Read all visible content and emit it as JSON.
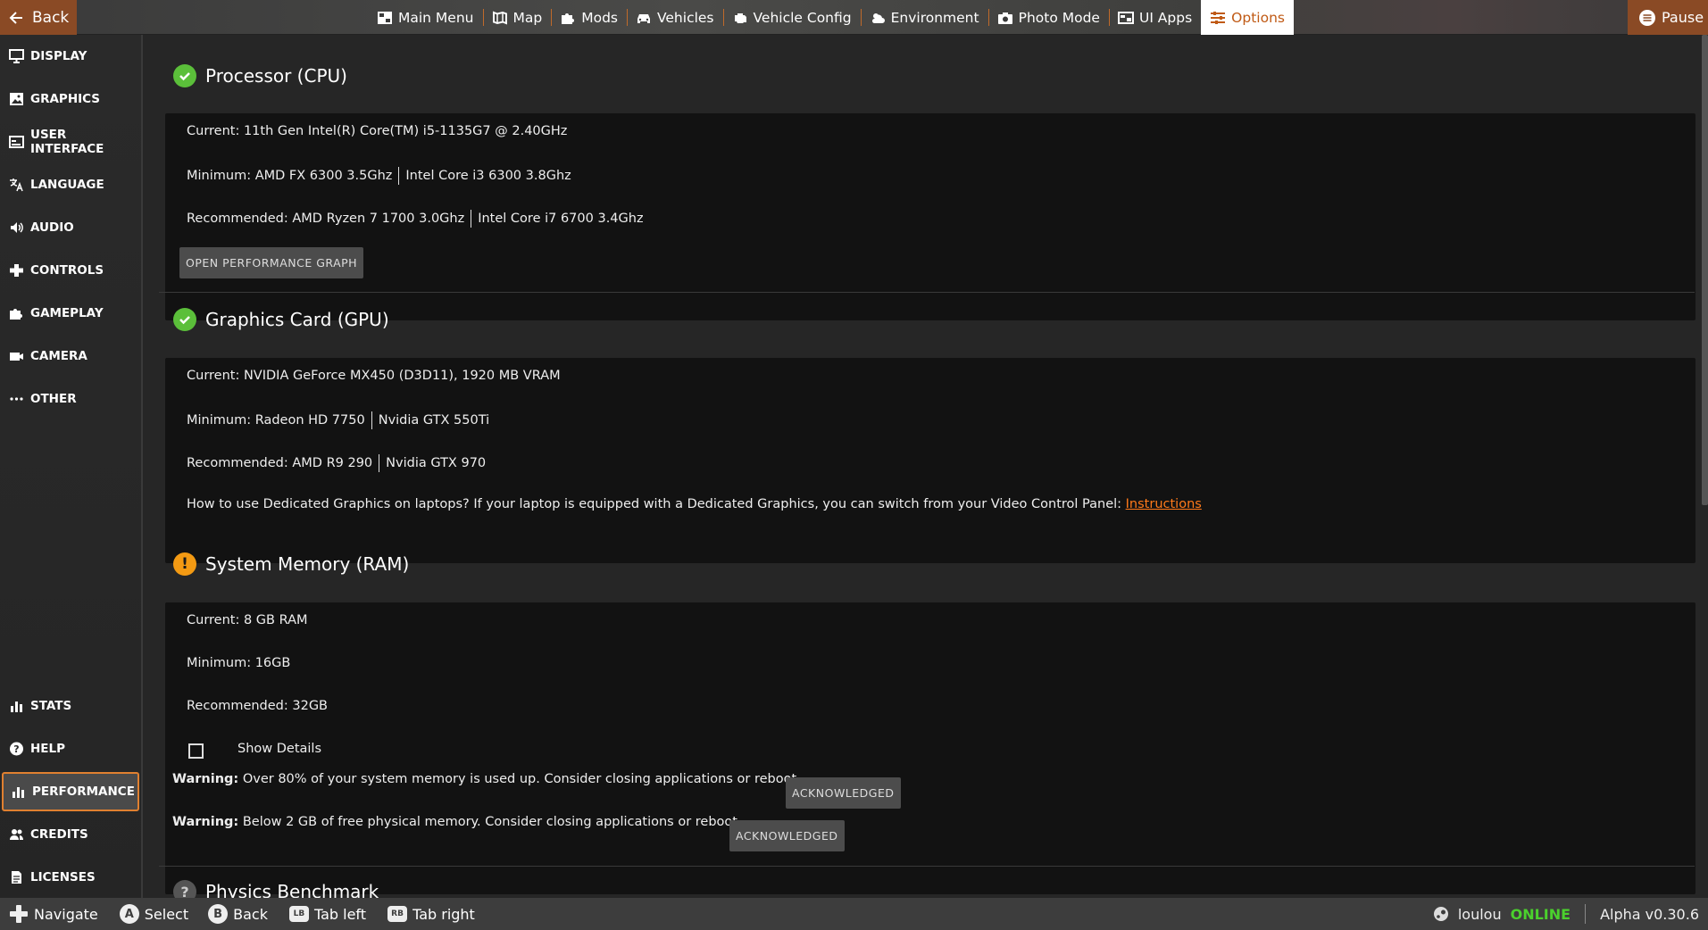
{
  "topbar": {
    "back_label": "Back",
    "pause_label": "Pause",
    "nav": [
      {
        "label": "Main Menu",
        "icon": "main-menu-icon"
      },
      {
        "label": "Map",
        "icon": "map-icon"
      },
      {
        "label": "Mods",
        "icon": "puzzle-icon"
      },
      {
        "label": "Vehicles",
        "icon": "car-icon"
      },
      {
        "label": "Vehicle Config",
        "icon": "engine-icon"
      },
      {
        "label": "Environment",
        "icon": "weather-icon"
      },
      {
        "label": "Photo Mode",
        "icon": "camera-icon"
      },
      {
        "label": "UI Apps",
        "icon": "ui-apps-icon"
      },
      {
        "label": "Options",
        "icon": "sliders-icon",
        "active": true
      }
    ]
  },
  "sidebar": {
    "items": [
      {
        "label": "DISPLAY",
        "icon": "monitor-icon"
      },
      {
        "label": "GRAPHICS",
        "icon": "image-icon"
      },
      {
        "label": "USER INTERFACE",
        "icon": "window-icon"
      },
      {
        "label": "LANGUAGE",
        "icon": "translate-icon"
      },
      {
        "label": "AUDIO",
        "icon": "speaker-icon"
      },
      {
        "label": "CONTROLS",
        "icon": "gamepad-icon"
      },
      {
        "label": "GAMEPLAY",
        "icon": "puzzle-icon"
      },
      {
        "label": "CAMERA",
        "icon": "video-icon"
      },
      {
        "label": "OTHER",
        "icon": "more-icon"
      }
    ],
    "bottom_items": [
      {
        "label": "STATS",
        "icon": "stats-icon"
      },
      {
        "label": "HELP",
        "icon": "help-icon"
      },
      {
        "label": "PERFORMANCE",
        "icon": "stats-icon",
        "active": true
      },
      {
        "label": "CREDITS",
        "icon": "people-icon"
      },
      {
        "label": "LICENSES",
        "icon": "document-icon"
      }
    ]
  },
  "cpu": {
    "title": "Processor (CPU)",
    "status": "ok",
    "current": "Current: 11th Gen Intel(R) Core(TM) i5-1135G7 @ 2.40GHz",
    "minimum_a": "Minimum: AMD FX 6300 3.5Ghz",
    "minimum_b": "Intel Core i3 6300 3.8Ghz",
    "recommended_a": "Recommended: AMD Ryzen 7 1700 3.0Ghz",
    "recommended_b": "Intel Core i7 6700 3.4Ghz",
    "graph_button": "OPEN PERFORMANCE GRAPH"
  },
  "gpu": {
    "title": "Graphics Card (GPU)",
    "status": "ok",
    "current": "Current: NVIDIA GeForce MX450 (D3D11), 1920 MB VRAM",
    "minimum_a": "Minimum: Radeon HD 7750",
    "minimum_b": "Nvidia GTX 550Ti",
    "recommended_a": "Recommended: AMD R9 290",
    "recommended_b": "Nvidia GTX 970",
    "laptop_note": "How to use Dedicated Graphics on laptops? If your laptop is equipped with a Dedicated Graphics, you can switch from your Video Control Panel: ",
    "instructions_link": "Instructions"
  },
  "ram": {
    "title": "System Memory (RAM)",
    "status": "warning",
    "status_glyph": "!",
    "current": "Current: 8 GB RAM",
    "minimum": "Minimum: 16GB",
    "recommended": "Recommended: 32GB",
    "show_details": "Show Details",
    "warnings": [
      {
        "prefix": "Warning:",
        "text": " Over 80% of your system memory is used up. Consider closing applications or reboot.",
        "button": "ACKNOWLEDGED"
      },
      {
        "prefix": "Warning:",
        "text": " Below 2 GB of free physical memory. Consider closing applications or reboot.",
        "button": "ACKNOWLEDGED"
      }
    ]
  },
  "physics": {
    "title": "Physics Benchmark",
    "status_glyph": "?"
  },
  "bottombar": {
    "hints": [
      {
        "key": "✥",
        "label": "Navigate"
      },
      {
        "key": "A",
        "label": "Select"
      },
      {
        "key": "B",
        "label": "Back"
      },
      {
        "key": "LB",
        "label": "Tab left"
      },
      {
        "key": "RB",
        "label": "Tab right"
      }
    ],
    "username": "loulou",
    "online_status": "ONLINE",
    "version": "Alpha v0.30.6"
  },
  "colors": {
    "accent": "#e08030",
    "ok": "#5bbf3a",
    "warning": "#f39a13",
    "online": "#4bd12d"
  }
}
